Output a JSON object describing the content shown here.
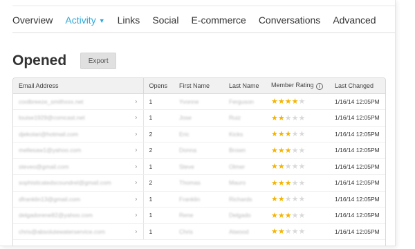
{
  "nav": {
    "items": [
      "Overview",
      "Activity",
      "Links",
      "Social",
      "E-commerce",
      "Conversations",
      "Advanced"
    ],
    "active": "Activity"
  },
  "page": {
    "title": "Opened",
    "export_label": "Export"
  },
  "table": {
    "headers": {
      "email": "Email Address",
      "opens": "Opens",
      "first": "First Name",
      "last": "Last Name",
      "rating": "Member Rating",
      "changed": "Last Changed"
    },
    "rows": [
      {
        "email": "coolbreeze_smithxxx.net",
        "opens": "1",
        "first": "Yvonne",
        "last": "Ferguson",
        "rating": 4,
        "changed": "1/16/14 12:05PM"
      },
      {
        "email": "louise1929@comcast.net",
        "opens": "1",
        "first": "Jose",
        "last": "Ruiz",
        "rating": 2,
        "changed": "1/16/14 12:05PM"
      },
      {
        "email": "djekolari@hotmail.com",
        "opens": "2",
        "first": "Eric",
        "last": "Kicks",
        "rating": 3,
        "changed": "1/16/14 12:05PM"
      },
      {
        "email": "mellesaw1@yahoo.com",
        "opens": "2",
        "first": "Donna",
        "last": "Brown",
        "rating": 3,
        "changed": "1/16/14 12:05PM"
      },
      {
        "email": "steveo@gmail.com",
        "opens": "1",
        "first": "Steve",
        "last": "Olmer",
        "rating": 2,
        "changed": "1/16/14 12:05PM"
      },
      {
        "email": "sophisticatedscoundrel@gmail.com",
        "opens": "2",
        "first": "Thomas",
        "last": "Mauro",
        "rating": 3,
        "changed": "1/16/14 12:05PM"
      },
      {
        "email": "dfranklin13@gmail.com",
        "opens": "1",
        "first": "Franklin",
        "last": "Richards",
        "rating": 2,
        "changed": "1/16/14 12:05PM"
      },
      {
        "email": "delgadorene82@yahoo.com",
        "opens": "1",
        "first": "Rene",
        "last": "Delgado",
        "rating": 3,
        "changed": "1/16/14 12:05PM"
      },
      {
        "email": "chris@absolutewaterservice.com",
        "opens": "1",
        "first": "Chris",
        "last": "Atwood",
        "rating": 2,
        "changed": "1/16/14 12:05PM"
      }
    ],
    "max_rating": 5
  },
  "icons": {
    "caret": "caret-down-icon",
    "info": "info-icon",
    "chevron": "chevron-right-icon",
    "star": "star-icon"
  },
  "colors": {
    "accent": "#2ea8d8",
    "star_on": "#f5b400",
    "star_off": "#d9d9d9"
  }
}
